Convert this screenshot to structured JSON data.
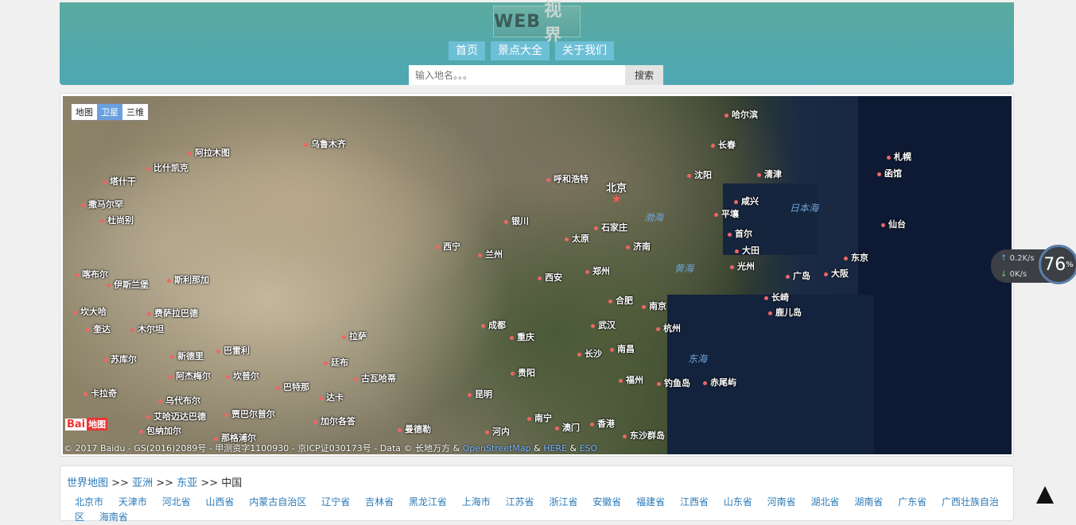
{
  "header": {
    "logo_part1": "WEB",
    "logo_part2": "视界",
    "nav": [
      "首页",
      "景点大全",
      "关于我们"
    ],
    "search_placeholder": "输入地名。。。",
    "search_button": "搜索"
  },
  "map": {
    "maptypes": [
      "地图",
      "卫星",
      "三维"
    ],
    "active_maptype": "卫星",
    "capital": "北京",
    "cities": [
      "哈尔滨",
      "长春",
      "札幌",
      "函馆",
      "乌鲁木齐",
      "阿拉木图",
      "比什凯克",
      "塔什干",
      "撒马尔罕",
      "杜尚别",
      "呼和浩特",
      "沈阳",
      "清津",
      "咸兴",
      "平壤",
      "首尔",
      "大田",
      "光州",
      "仙台",
      "东京",
      "大阪",
      "广岛",
      "长崎",
      "鹿儿岛",
      "银川",
      "石家庄",
      "太原",
      "济南",
      "西宁",
      "兰州",
      "郑州",
      "西安",
      "喀布尔",
      "伊斯兰堡",
      "斯利那加",
      "坎大哈",
      "费萨拉巴德",
      "奎达",
      "木尔坦",
      "合肥",
      "南京",
      "武汉",
      "杭州",
      "拉萨",
      "成都",
      "重庆",
      "长沙",
      "南昌",
      "苏库尔",
      "新德里",
      "巴雷利",
      "阿杰梅尔",
      "坎普尔",
      "廷布",
      "古瓦哈蒂",
      "贵阳",
      "福州",
      "钓鱼岛",
      "赤尾屿",
      "卡拉奇",
      "乌代布尔",
      "巴特那",
      "达卡",
      "昆明",
      "艾哈迈达巴德",
      "贾巴尔普尔",
      "加尔各答",
      "曼德勒",
      "南宁",
      "香港",
      "澳门",
      "东沙群岛",
      "包纳加尔",
      "那格浦尔",
      "河内"
    ],
    "seas": [
      "渤海",
      "日本海",
      "黄海",
      "东海"
    ],
    "copyright_text": "© 2017 Baidu - GS(2016)2089号 - 甲测资字1100930 - 京ICP证030173号 - Data © 长地万方 & ",
    "copyright_link1": "OpenStreetMap",
    "copyright_mid": " & ",
    "copyright_link2": "HERE",
    "copyright_mid2": " & ",
    "copyright_link3": "ESO",
    "baidu_logo1": "Bai",
    "baidu_logo2": "地图"
  },
  "netmonitor": {
    "upload": "0.2",
    "upload_unit": "K/s",
    "download": "0",
    "download_unit": "K/s",
    "gauge_value": "76",
    "gauge_unit": "%"
  },
  "breadcrumb": {
    "level1": "世界地图",
    "level2": "亚洲",
    "level3": "东亚",
    "current": "中国",
    "sep": ">>"
  },
  "provinces": [
    "北京市",
    "天津市",
    "河北省",
    "山西省",
    "内蒙古自治区",
    "辽宁省",
    "吉林省",
    "黑龙江省",
    "上海市",
    "江苏省",
    "浙江省",
    "安徽省",
    "福建省",
    "江西省",
    "山东省",
    "河南省",
    "湖北省",
    "湖南省",
    "广东省",
    "广西壮族自治区",
    "海南省"
  ]
}
